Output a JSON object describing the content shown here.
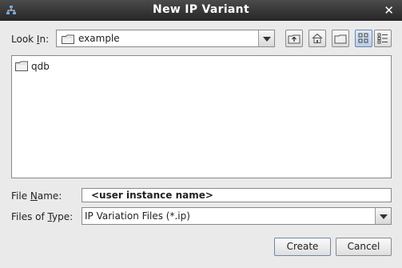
{
  "window": {
    "title": "New IP Variant"
  },
  "look_in": {
    "label_pre": "Look ",
    "label_ul": "I",
    "label_post": "n:",
    "value": "example"
  },
  "toolbar": {
    "up": "up-folder-icon",
    "home": "home-icon",
    "new_folder": "new-folder-icon",
    "list_view": "list-view-icon",
    "details_view": "details-view-icon"
  },
  "files": [
    {
      "name": "qdb",
      "icon": "folder-icon"
    }
  ],
  "file_name": {
    "label_pre": "File ",
    "label_ul": "N",
    "label_post": "ame:",
    "value": "<user instance name>"
  },
  "file_type": {
    "label_pre": "Files of ",
    "label_ul": "T",
    "label_post": "ype:",
    "value": "IP Variation Files (*.ip)"
  },
  "buttons": {
    "create": "Create",
    "cancel": "Cancel"
  },
  "colors": {
    "titlebar": "#303030",
    "accent": "#6d87ad"
  }
}
